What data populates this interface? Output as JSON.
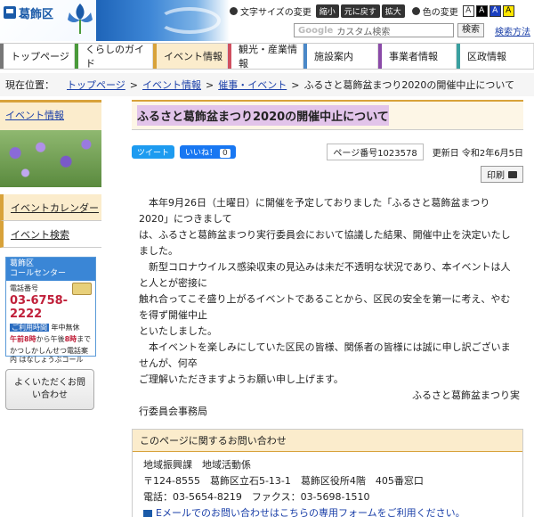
{
  "header": {
    "site_name": "葛飾区",
    "text_size_label": "文字サイズの変更",
    "shrink": "縮小",
    "reset": "元に戻す",
    "enlarge": "拡大",
    "color_label": "色の変更",
    "swatch": "A",
    "search_placeholder": "カスタム検索",
    "search_brand": "Google",
    "search_button": "検索",
    "search_help": "検索方法"
  },
  "nav": [
    {
      "label": "トップページ"
    },
    {
      "label": "くらしのガイド"
    },
    {
      "label": "イベント情報"
    },
    {
      "label": "観光・産業情報"
    },
    {
      "label": "施設案内"
    },
    {
      "label": "事業者情報"
    },
    {
      "label": "区政情報"
    }
  ],
  "breadcrumb": {
    "label": "現在位置：",
    "items": [
      "トップページ",
      "イベント情報",
      "催事・イベント"
    ],
    "current": "ふるさと葛飾盆まつり2020の開催中止について",
    "separator": ">"
  },
  "sidebar": {
    "title": "イベント情報",
    "links": [
      "イベントカレンダー",
      "イベント検索"
    ],
    "callcenter": {
      "title_line1": "葛飾区",
      "title_line2": "コールセンター",
      "tel_label": "電話番号",
      "tel": "03-6758-2222",
      "hours_tag": "ご利用時間",
      "hours_days": "年中無休",
      "hours_from": "午前8時",
      "hours_mid": "から午後",
      "hours_to": "8時",
      "hours_end": "まで",
      "foot": "かつしかしんせつ電話案内 はなしょうぶコール"
    },
    "inquiry_button": "よくいただくお問い合わせ"
  },
  "main": {
    "title": "ふるさと葛飾盆まつり2020の開催中止について",
    "tweet": "ツイート",
    "like": "いいね！",
    "like_count": "0",
    "page_number": "ページ番号1023578",
    "updated": "更新日 令和2年6月5日",
    "print": "印刷",
    "paragraphs": [
      "　本年9月26日（土曜日）に開催を予定しておりました「ふるさと葛飾盆まつり2020」につきまして",
      "は、ふるさと葛飾盆まつり実行委員会において協議した結果、開催中止を決定いたしました。",
      "　新型コロナウイルス感染収束の見込みは未だ不透明な状況であり、本イベントは人と人とが密接に",
      "触れ合ってこそ盛り上がるイベントであることから、区民の安全を第一に考え、やむを得ず開催中止",
      "といたしました。",
      "　本イベントを楽しみにしていた区民の皆様、関係者の皆様には誠に申し訳ございませんが、何卒",
      "ご理解いただきますようお願い申し上げます。"
    ],
    "signature_1": "ふるさと葛飾盆まつり実",
    "signature_2": "行委員会事務局"
  },
  "contact": {
    "heading": "このページに関するお問い合わせ",
    "dept": "地域振興課　地域活動係",
    "address": "〒124-8555　葛飾区立石5-13-1　葛飾区役所4階　405番窓口",
    "phone": "電話：03-5654-8219　ファクス：03-5698-1510",
    "email_link": "Eメールでのお問い合わせはこちらの専用フォームをご利用ください。"
  },
  "colors": {
    "event_accent": "#d8a23a",
    "link": "#1a3fa8",
    "title_highlight": "#e2c4ea"
  }
}
